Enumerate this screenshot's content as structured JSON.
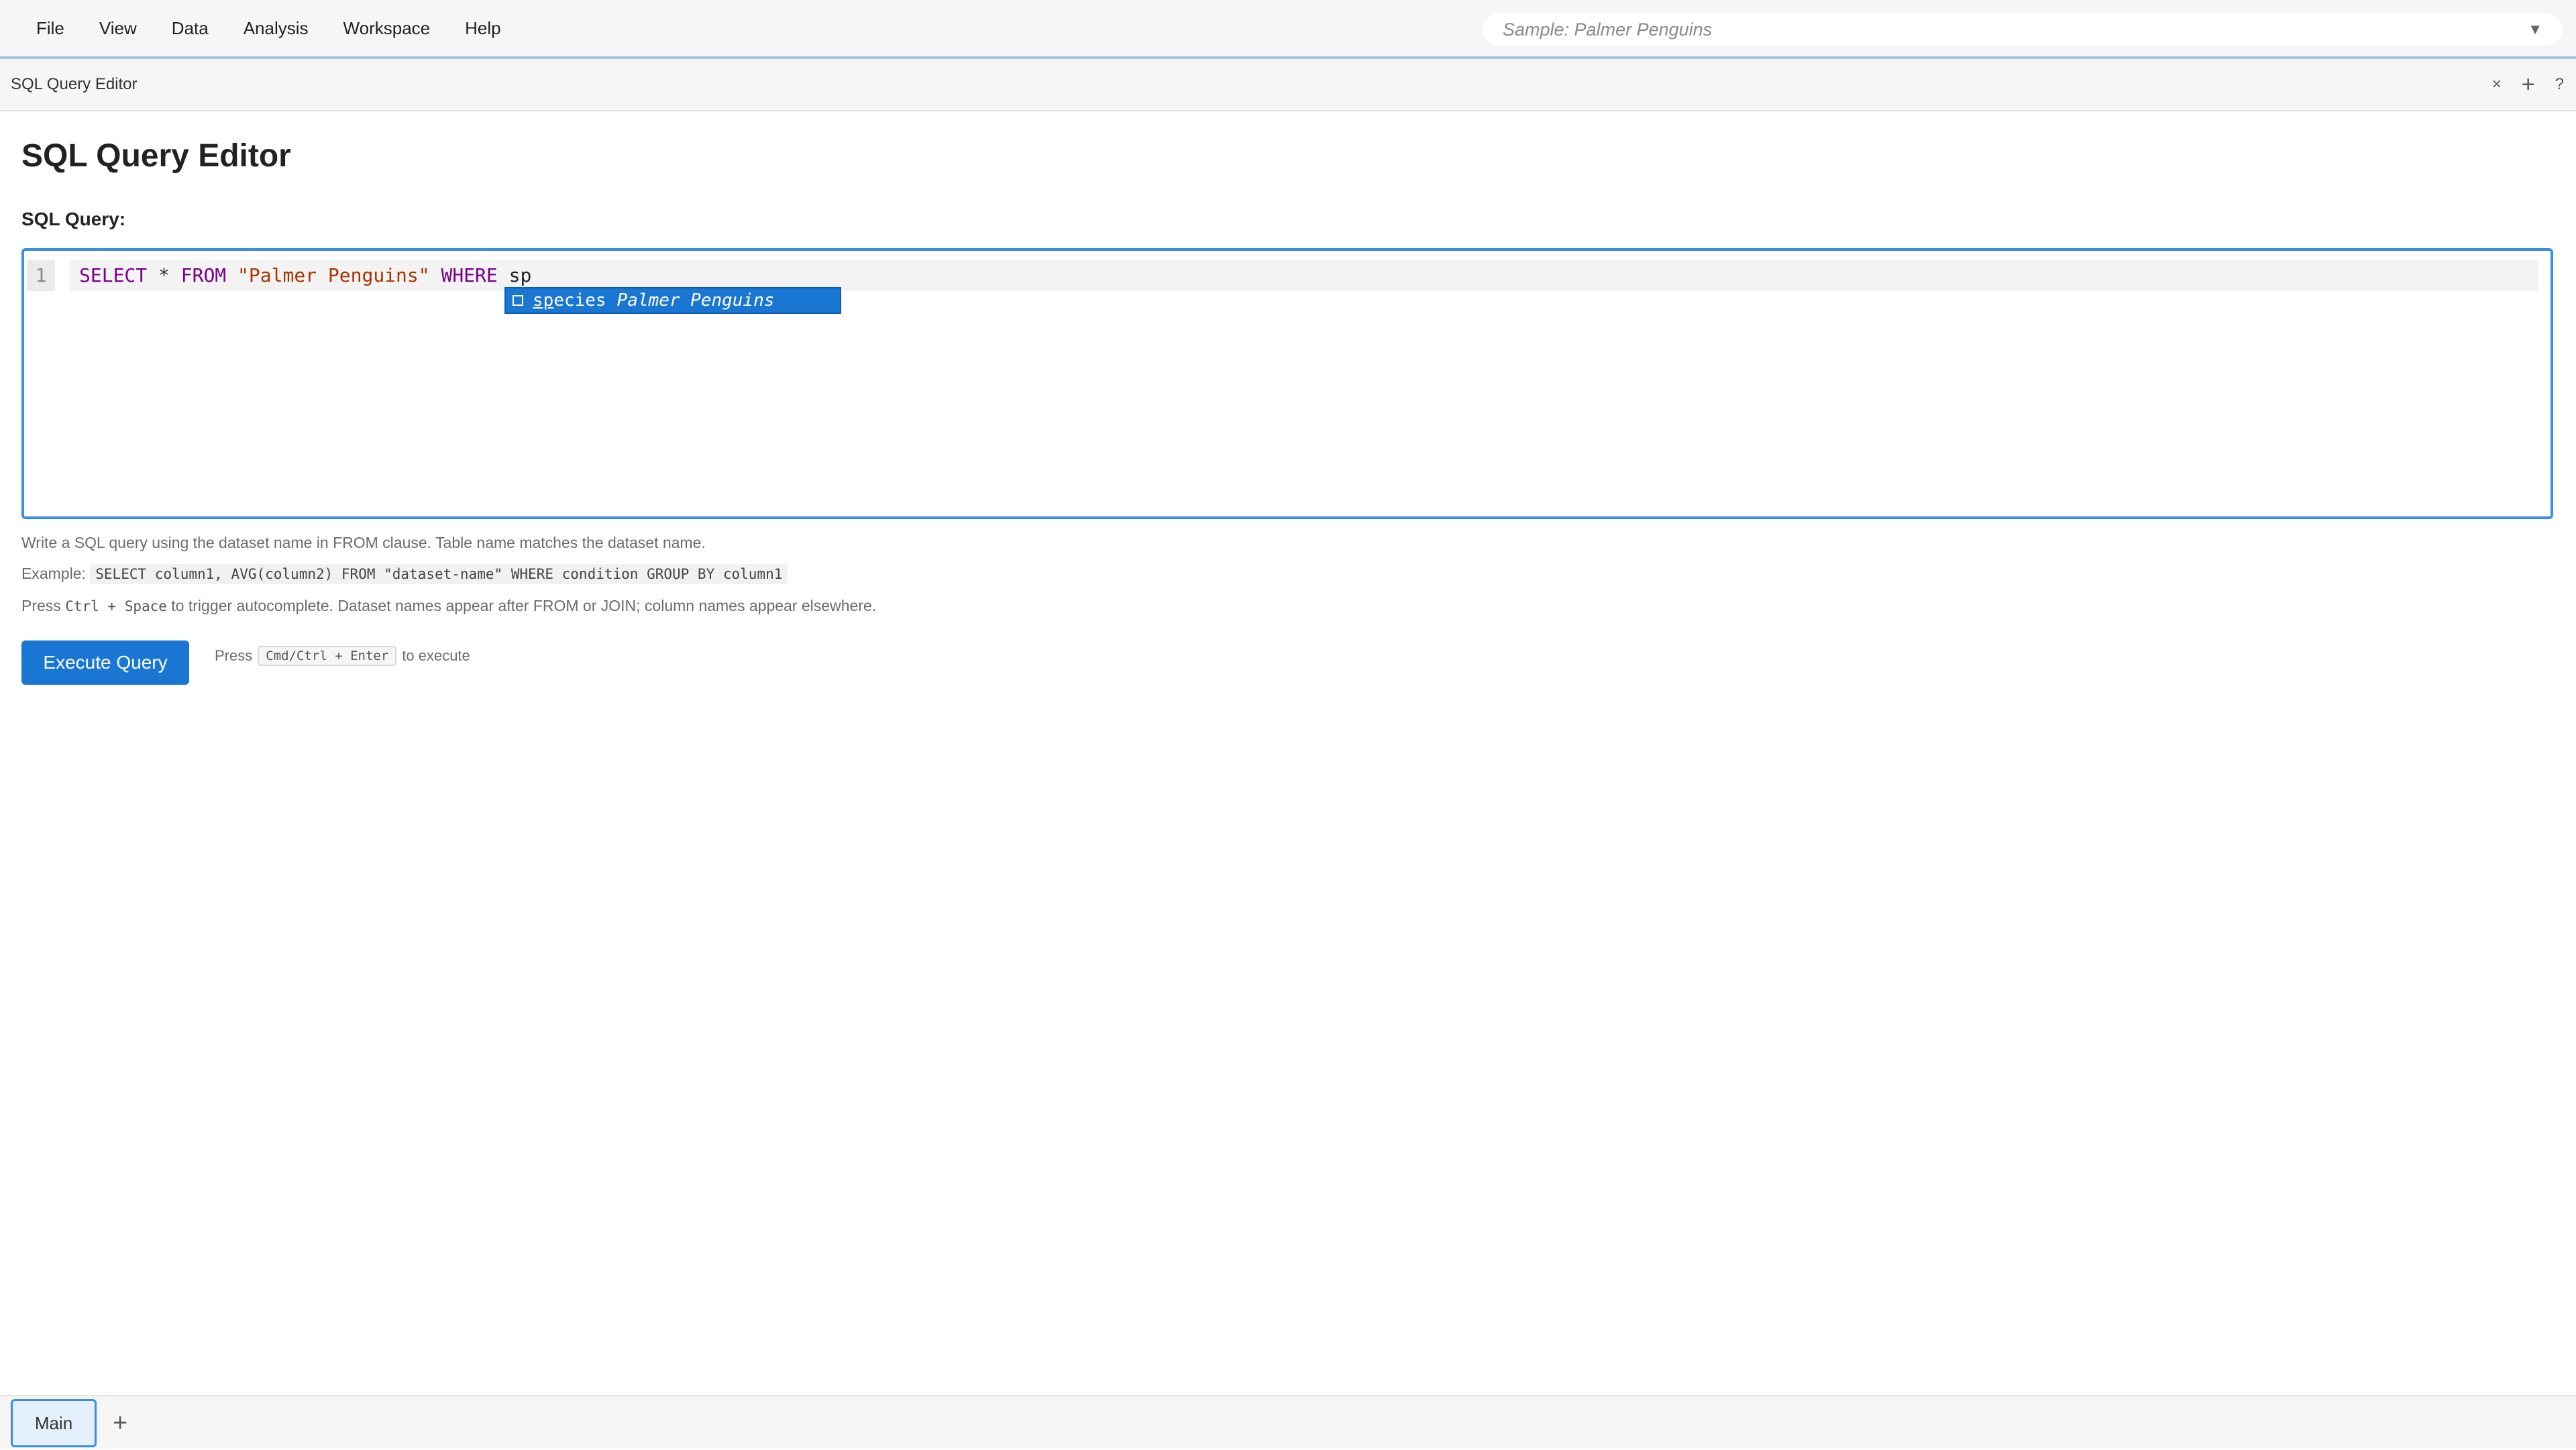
{
  "menu": {
    "items": [
      "File",
      "View",
      "Data",
      "Analysis",
      "Workspace",
      "Help"
    ]
  },
  "dataset_selector": {
    "value": "Sample: Palmer Penguins",
    "caret": "▼"
  },
  "panel": {
    "title": "SQL Query Editor",
    "close": "×",
    "add": "+",
    "help": "?"
  },
  "page": {
    "title": "SQL Query Editor",
    "query_label": "SQL Query:"
  },
  "editor": {
    "line_number": "1",
    "tokens": {
      "select": "SELECT",
      "star": " * ",
      "from": "FROM",
      "table": " \"Palmer Penguins\" ",
      "where": "WHERE",
      "typed": " sp"
    }
  },
  "autocomplete": {
    "match": "sp",
    "rest": "ecies",
    "detail": "Palmer Penguins"
  },
  "help": {
    "line1": "Write a SQL query using the dataset name in FROM clause. Table name matches the dataset name.",
    "example_label": "Example: ",
    "example_code": "SELECT column1, AVG(column2) FROM \"dataset-name\" WHERE condition GROUP BY column1",
    "line3_prefix": "Press ",
    "line3_keys": "Ctrl + Space",
    "line3_suffix": " to trigger autocomplete. Dataset names appear after FROM or JOIN; column names appear elsewhere."
  },
  "execute": {
    "button_label": "Execute Query",
    "hint_prefix": "Press",
    "hint_keys": "Cmd/Ctrl + Enter",
    "hint_suffix": "to execute"
  },
  "bottom_tabs": {
    "main": "Main",
    "add": "+"
  },
  "colors": {
    "accent": "#1976d2",
    "keyword": "#770088",
    "string": "#aa3300"
  }
}
